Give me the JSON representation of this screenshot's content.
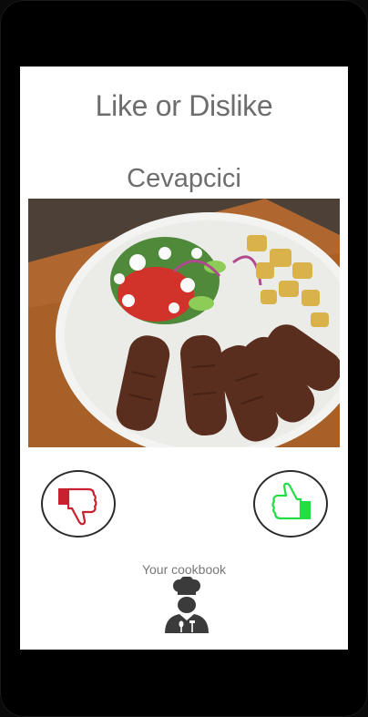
{
  "screen": {
    "title": "Like or Dislike",
    "dish_name": "Cevapcici"
  },
  "photo": {
    "alt": "Cevapcici"
  },
  "actions": {
    "dislike_icon": "thumbs-down-icon",
    "like_icon": "thumbs-up-icon"
  },
  "cookbook": {
    "label": "Your cookbook",
    "icon": "chef-icon"
  },
  "colors": {
    "dislike": "#c8202e",
    "like": "#22dd44",
    "text": "#6d6d6d"
  }
}
